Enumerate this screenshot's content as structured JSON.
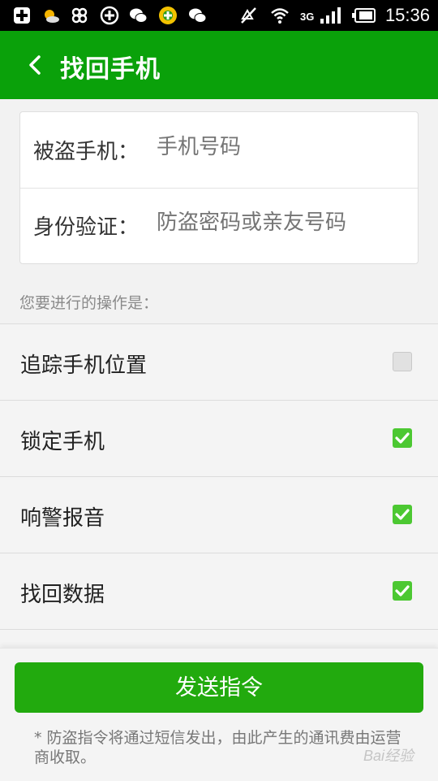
{
  "status_bar": {
    "time": "15:36",
    "network": "3G",
    "icons": [
      "add-box-icon",
      "weather-sun-icon",
      "butterfly-icon",
      "plus-circle-icon",
      "wechat-icon",
      "game-icon",
      "wechat-icon",
      "mute-icon",
      "wifi-icon",
      "signal-icon",
      "battery-icon"
    ]
  },
  "header": {
    "title": "找回手机"
  },
  "form": {
    "phone_label": "被盗手机：",
    "phone_placeholder": "手机号码",
    "auth_label": "身份验证：",
    "auth_placeholder": "防盗密码或亲友号码"
  },
  "section_label": "您要进行的操作是：",
  "options": [
    {
      "label": "追踪手机位置",
      "checked": false
    },
    {
      "label": "锁定手机",
      "checked": true
    },
    {
      "label": "响警报音",
      "checked": true
    },
    {
      "label": "找回数据",
      "checked": true
    }
  ],
  "footer": {
    "send_label": "发送指令",
    "note": "* 防盗指令将通过短信发出，由此产生的通讯费由运营商收取。"
  },
  "watermark": "Bai经验",
  "colors": {
    "title_bar": "#0aa10a",
    "button": "#22aa0e",
    "checkbox_on": "#4cc832"
  }
}
